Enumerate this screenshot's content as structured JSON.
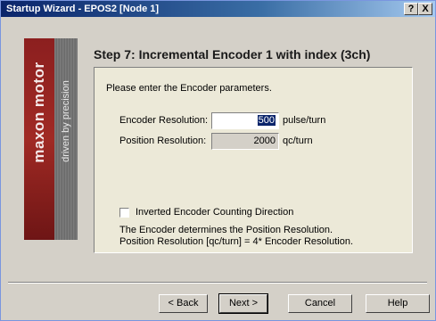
{
  "window": {
    "title": "Startup Wizard - EPOS2 [Node 1]",
    "help_glyph": "?",
    "close_glyph": "X"
  },
  "brand": {
    "name": "maxon motor",
    "tagline": "driven by precision",
    "colors": {
      "red": "#a02a24",
      "gray": "#7a7a7a"
    }
  },
  "step": {
    "title": "Step 7: Incremental Encoder 1 with index (3ch)",
    "prompt": "Please enter the Encoder parameters."
  },
  "form": {
    "encoder_resolution": {
      "label": "Encoder Resolution:",
      "value": "500",
      "unit": "pulse/turn"
    },
    "position_resolution": {
      "label": "Position Resolution:",
      "value": "2000",
      "unit": "qc/turn"
    },
    "inverted_direction": {
      "label": "Inverted Encoder Counting Direction",
      "checked": false
    }
  },
  "info": {
    "line1": "The Encoder determines the Position Resolution.",
    "line2": "Position Resolution [qc/turn] = 4* Encoder Resolution."
  },
  "buttons": {
    "back": "< Back",
    "next": "Next >",
    "cancel": "Cancel",
    "help": "Help"
  }
}
